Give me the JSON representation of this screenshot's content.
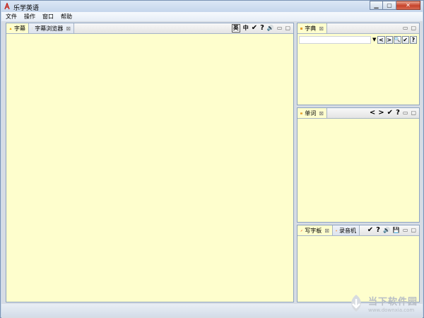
{
  "window": {
    "title": "乐学英语"
  },
  "menu": [
    "文件",
    "操作",
    "窗口",
    "帮助"
  ],
  "main_panel": {
    "tabs": [
      {
        "label": "字幕",
        "active": true
      },
      {
        "label": "字幕浏览器",
        "active": false
      }
    ],
    "tools": {
      "en": "英",
      "zh": "中",
      "check": "✔",
      "help": "?",
      "speaker": "🔊"
    }
  },
  "dict_panel": {
    "tab": "字典",
    "search": {
      "value": "",
      "placeholder": ""
    },
    "buttons": {
      "prev": "<",
      "next": ">",
      "search": "🔍",
      "check": "✔",
      "help": "?"
    }
  },
  "words_panel": {
    "tab": "单词",
    "tools": {
      "prev": "<",
      "next": ">",
      "check": "✔",
      "help": "?"
    }
  },
  "bottom_panel": {
    "tabs": [
      {
        "label": "写字板",
        "active": true
      },
      {
        "label": "录音机",
        "active": false
      }
    ],
    "tools": {
      "check": "✔",
      "help": "?",
      "speaker": "🔊",
      "save": "💾"
    }
  },
  "watermark": {
    "cn": "当下软件园",
    "url": "www.downxia.com"
  },
  "colors": {
    "panel_bg": "#fefecd",
    "border": "#8ea4c1",
    "close_button": "#c7432a"
  }
}
